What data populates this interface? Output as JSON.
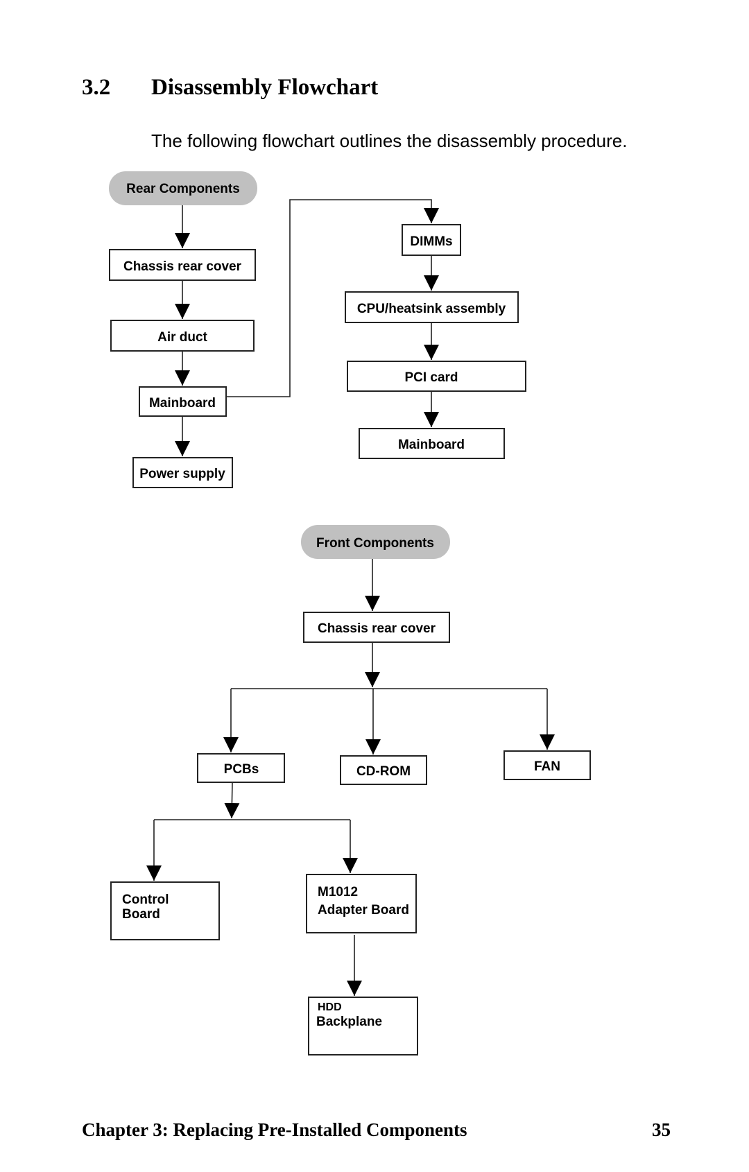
{
  "section": {
    "number": "3.2",
    "title": "Disassembly Flowchart",
    "intro": "The following flowchart outlines the disassembly procedure."
  },
  "diagram": {
    "rear": {
      "start": "Rear Components",
      "left_column": [
        "Chassis rear cover",
        "Air duct",
        "Mainboard",
        "Power supply"
      ],
      "right_column": [
        "DIMMs",
        "CPU/heatsink assembly",
        "PCI card",
        "Mainboard"
      ]
    },
    "front": {
      "start": "Front Components",
      "first_step": "Chassis rear cover",
      "branches": [
        "PCBs",
        "CD-ROM",
        "FAN"
      ],
      "pcb_branches": {
        "control_board": [
          "Control",
          "Board"
        ],
        "adapter_board": [
          "M1012",
          "Adapter Board"
        ]
      },
      "hdd_backplane": [
        "HDD",
        "Backplane"
      ]
    },
    "edges": [
      [
        "Rear Components",
        "Chassis rear cover"
      ],
      [
        "Chassis rear cover",
        "Air duct"
      ],
      [
        "Air duct",
        "Mainboard"
      ],
      [
        "Mainboard",
        "Power supply"
      ],
      [
        "Mainboard",
        "DIMMs"
      ],
      [
        "DIMMs",
        "CPU/heatsink assembly"
      ],
      [
        "CPU/heatsink assembly",
        "PCI card"
      ],
      [
        "PCI card",
        "Mainboard"
      ],
      [
        "Front Components",
        "Chassis rear cover"
      ],
      [
        "Chassis rear cover",
        "PCBs"
      ],
      [
        "Chassis rear cover",
        "CD-ROM"
      ],
      [
        "Chassis rear cover",
        "FAN"
      ],
      [
        "PCBs",
        "Control Board"
      ],
      [
        "PCBs",
        "M1012 Adapter Board"
      ],
      [
        "M1012 Adapter Board",
        "HDD Backplane"
      ]
    ]
  },
  "footer": {
    "chapter": "Chapter 3: Replacing Pre-Installed Components",
    "page": "35"
  }
}
